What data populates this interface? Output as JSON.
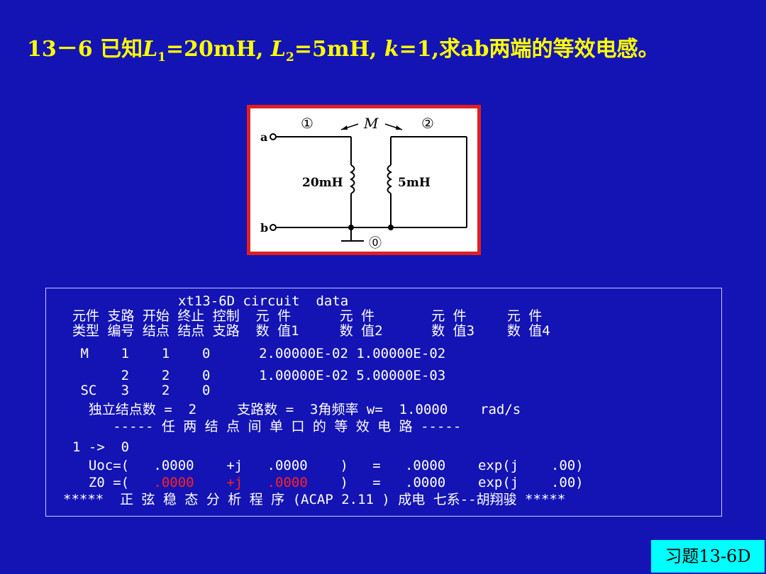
{
  "title": {
    "prefix": "13－6 已知",
    "L": "L",
    "sub1": "1",
    "part1": "=20mH, ",
    "sub2": "2",
    "part2": "=5mH, ",
    "k": "k",
    "part3": "=1,求ab两端的等效电感。"
  },
  "circuit": {
    "node1": "①",
    "node2": "②",
    "node0": "⓪",
    "mutual": "M",
    "terminal_a": "a",
    "terminal_b": "b",
    "inductor1": "20mH",
    "inductor2": "5mH"
  },
  "console": {
    "header": "xt13-6D circuit  data",
    "col_row1": "元件 支路 开始 终止 控制  元 件      元 件       元 件     元 件",
    "col_row2": "类型 编号 结点 结点 支路  数 值1     数 值2      数 值3    数 值4",
    "row_m": " M    1    1    0      2.00000E-02 1.00000E-02",
    "row_2": "      2    2    0      1.00000E-02 5.00000E-03",
    "row_sc": " SC   3    2    0",
    "summary": "  独立结点数 =  2     支路数 =  3角频率 w=  1.0000    rad/s",
    "eq_title": "     ----- 任 两 结 点 间 单 口 的 等 效 电 路 -----",
    "path": "1 ->  0",
    "uoc": "  Uoc=(   .0000    +j   .0000    )   =   .0000    exp(j    .00)",
    "z0_prefix": "  Z0 =(   ",
    "z0_re": ".0000",
    "z0_gap1": "    ",
    "z0_j": "+j",
    "z0_gap2": "   ",
    "z0_im": ".0000",
    "z0_suffix": "    )   =   .0000    exp(j    .00)",
    "footer": "*****  正 弦 稳 态 分 析 程 序 (ACAP 2.11 ) 成电 七系--胡翔骏 *****"
  },
  "exercise_tag": "习题13-6D"
}
